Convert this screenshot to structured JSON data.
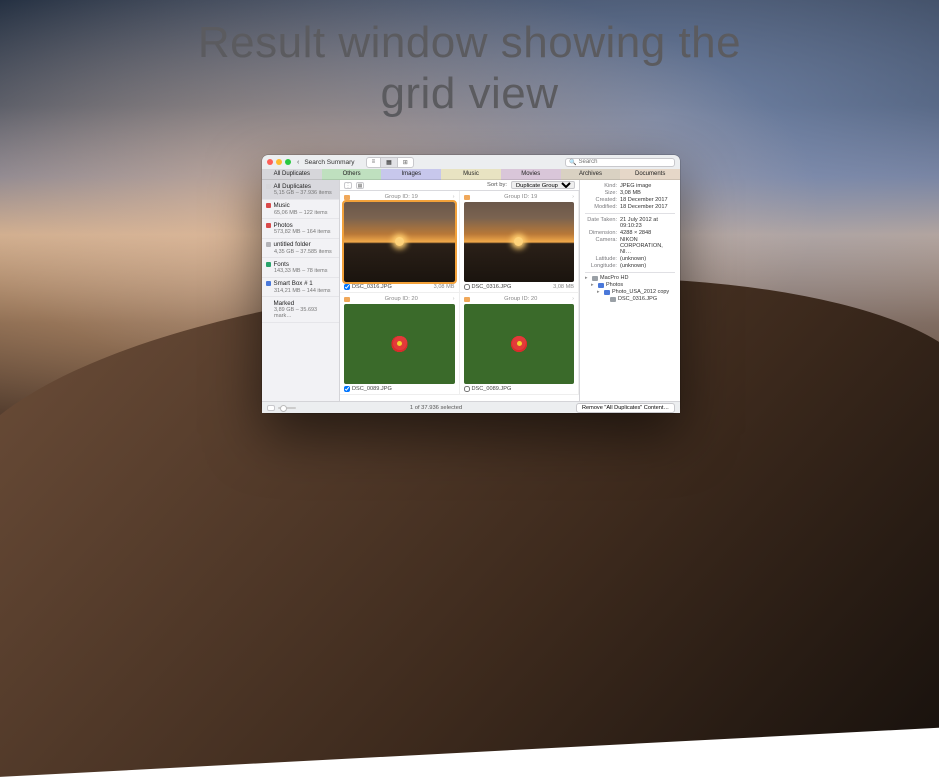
{
  "headline_l1": "Result window showing the",
  "headline_l2": "grid view",
  "titlebar": {
    "back_glyph": "‹",
    "title": "Search Summary",
    "search_placeholder": "Search",
    "view_list": "≡",
    "view_grid": "▦",
    "view_col": "⊞"
  },
  "tabs": [
    "All Duplicates",
    "Others",
    "Images",
    "Music",
    "Movies",
    "Archives",
    "Documents"
  ],
  "sidebar": [
    {
      "color": "#d6d6da",
      "name": "All Duplicates",
      "sub": "5,15 GB – 37.936 items",
      "sel": true
    },
    {
      "color": "#d94a4a",
      "name": "Music",
      "sub": "65,06 MB – 122 items"
    },
    {
      "color": "#d94a4a",
      "name": "Photos",
      "sub": "573,82 MB – 164 items"
    },
    {
      "color": "#b4b4b8",
      "name": "untitled folder",
      "sub": "4,35 GB – 37.585 items"
    },
    {
      "color": "#2aa36a",
      "name": "Fonts",
      "sub": "143,33 MB – 78 items"
    },
    {
      "color": "#4a78d9",
      "name": "Smart Box # 1",
      "sub": "314,21 MB – 144 items"
    },
    {
      "color": "",
      "name": "Marked",
      "sub": "3,89 GB – 35.693 mark…"
    }
  ],
  "sortbar": {
    "sort_label": "Sort by:",
    "sort_value": "Duplicate Group"
  },
  "grid": [
    {
      "group": "Group ID: 19",
      "file": "DSC_0316.JPG",
      "size": "3,08 MB",
      "checked": true,
      "sel": true,
      "img": "sunset"
    },
    {
      "group": "Group ID: 19",
      "file": "DSC_0316.JPG",
      "size": "3,08 MB",
      "checked": false,
      "sel": false,
      "img": "sunset"
    },
    {
      "group": "Group ID: 20",
      "file": "DSC_0089.JPG",
      "size": "",
      "checked": true,
      "sel": false,
      "img": "flower"
    },
    {
      "group": "Group ID: 20",
      "file": "DSC_0089.JPG",
      "size": "",
      "checked": false,
      "sel": false,
      "img": "flower"
    }
  ],
  "inspector": {
    "rows1": [
      {
        "k": "Kind:",
        "v": "JPEG image"
      },
      {
        "k": "Size:",
        "v": "3,08 MB"
      },
      {
        "k": "Created:",
        "v": "18 December 2017"
      },
      {
        "k": "Modified:",
        "v": "18 December 2017"
      }
    ],
    "rows2": [
      {
        "k": "Date Taken:",
        "v": "21 July 2012 at 09:10:23"
      },
      {
        "k": "Dimension:",
        "v": "4288 × 2848"
      },
      {
        "k": "Camera:",
        "v": "NIKON CORPORATION, NI…"
      },
      {
        "k": "Latitude:",
        "v": "(unknown)"
      },
      {
        "k": "Longitude:",
        "v": "(unknown)"
      }
    ],
    "tree": [
      {
        "lvl": 0,
        "tri": "▸",
        "color": "#9aa0a6",
        "name": "MacPro HD"
      },
      {
        "lvl": 1,
        "tri": "▸",
        "color": "#4a78d9",
        "name": "Photos"
      },
      {
        "lvl": 2,
        "tri": "▸",
        "color": "#4a78d9",
        "name": "Photo_USA_2012 copy"
      },
      {
        "lvl": 3,
        "tri": "",
        "color": "#9aa0a6",
        "name": "DSC_0316.JPG"
      }
    ]
  },
  "statusbar": {
    "selected": "1 of 37.936 selected",
    "remove": "Remove \"All Duplicates\" Content…"
  }
}
